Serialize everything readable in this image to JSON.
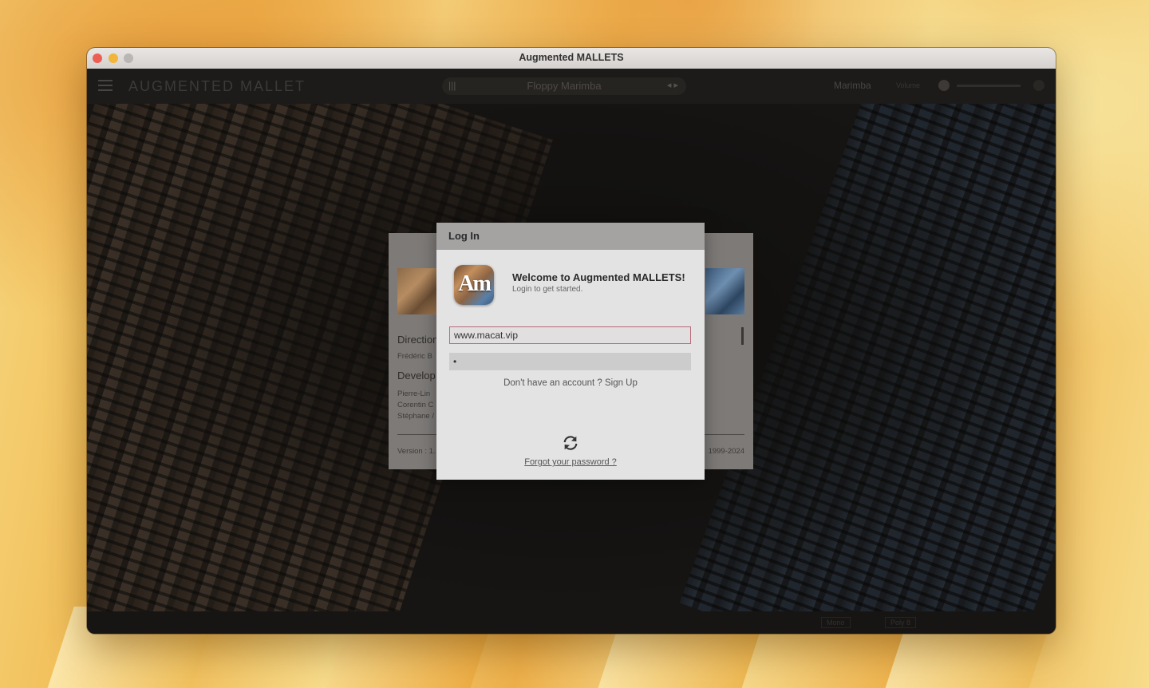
{
  "window": {
    "title": "Augmented MALLETS"
  },
  "header": {
    "logo": "AUGMENTED MALLET",
    "preset_name": "Floppy Marimba",
    "preset_arrows": "◂ ▸",
    "instrument": "Marimba",
    "volume_label": "Volume"
  },
  "footer": {
    "button_1": "Mono",
    "button_2": "Poly 8"
  },
  "about": {
    "direction_heading": "Direction",
    "direction_names": "Frédéric B",
    "development_heading": "Develop",
    "dev_names": [
      "Pierre-Lin",
      "Corentin C",
      "Stéphane /"
    ],
    "version": "Version : 1.",
    "copyright": "1999-2024"
  },
  "login": {
    "title": "Log In",
    "welcome": "Welcome to Augmented MALLETS!",
    "subtitle": "Login to get started.",
    "app_icon_text": "Am",
    "username_value": "www.macat.vip",
    "password_value": "•",
    "signup_text": "Don't have an account ? Sign Up",
    "forgot_text": "Forgot your password ?"
  },
  "colors": {
    "input_focus_border": "#b86c7a",
    "dialog_bg": "#e4e3e3",
    "dialog_header": "#a4a3a2"
  }
}
